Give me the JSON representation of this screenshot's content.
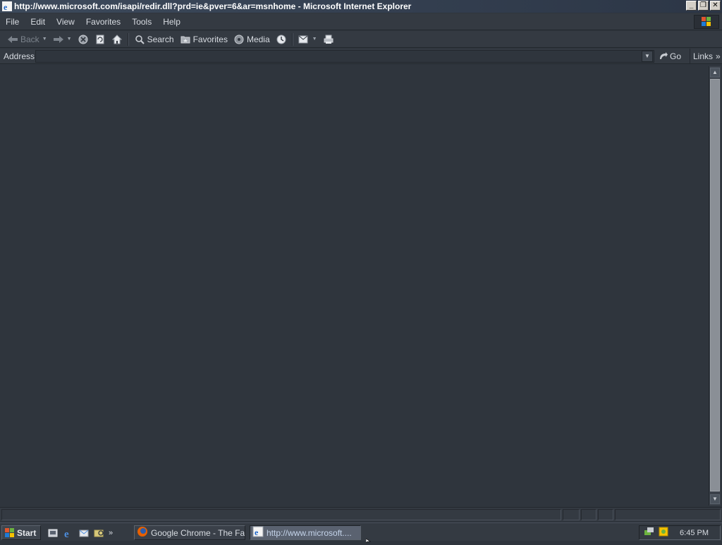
{
  "window": {
    "title": "http://www.microsoft.com/isapi/redir.dll?prd=ie&pver=6&ar=msnhome - Microsoft Internet Explorer",
    "minimize_glyph": "_",
    "restore_glyph": "❐",
    "close_glyph": "✕"
  },
  "menu": {
    "items": [
      "File",
      "Edit",
      "View",
      "Favorites",
      "Tools",
      "Help"
    ]
  },
  "toolbar": {
    "back_label": "Back",
    "search_label": "Search",
    "favorites_label": "Favorites",
    "media_label": "Media"
  },
  "address": {
    "label": "Address",
    "value": "",
    "go_label": "Go",
    "links_label": "Links"
  },
  "taskbar": {
    "start_label": "Start",
    "tasks": [
      {
        "label": "Google Chrome - The Fas..."
      },
      {
        "label": "http://www.microsoft...."
      }
    ],
    "clock": "6:45 PM"
  },
  "colors": {
    "background": "#2f353d",
    "chrome": "#343a42",
    "titlebar": "#3d4a5c"
  }
}
